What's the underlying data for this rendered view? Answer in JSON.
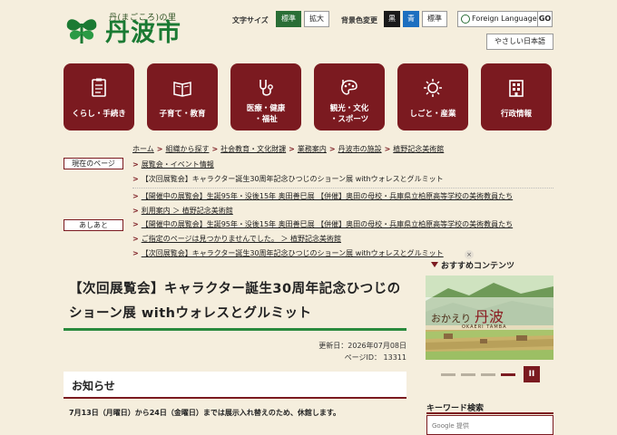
{
  "site": {
    "tagline": "丹(まごころ)の里",
    "name": "丹波市"
  },
  "utility": {
    "font_size_label": "文字サイズ",
    "font_standard": "標準",
    "font_large": "拡大",
    "bg_label": "背景色変更",
    "bg_black": "黒",
    "bg_blue": "青",
    "bg_standard": "標準",
    "language": "Foreign Language",
    "go": "GO",
    "easy_japanese": "やさしい日本語"
  },
  "nav": [
    {
      "label": "くらし・手続き",
      "icon": "document-icon"
    },
    {
      "label": "子育て・教育",
      "icon": "book-icon"
    },
    {
      "label": "医療・健康\n・福祉",
      "icon": "stethoscope-icon"
    },
    {
      "label": "観光・文化\n・スポーツ",
      "icon": "palette-icon"
    },
    {
      "label": "しごと・産業",
      "icon": "sun-icon"
    },
    {
      "label": "行政情報",
      "icon": "building-icon"
    }
  ],
  "breadcrumb": {
    "current_label": "現在のページ",
    "current_path": [
      "ホーム",
      "組織から探す",
      "社会教育・文化財課",
      "業務案内",
      "丹波市の施設",
      "植野記念美術館"
    ],
    "current_sub": "展覧会・イベント情報",
    "current_page": "【次回展覧会】キャラクター誕生30周年記念ひつじのショーン展 withウォレスとグルミット",
    "history_label": "あしあと",
    "history": [
      "【開催中の展覧会】生誕95年・没後15年 奥田善巳展 【併催】奥田の母校・兵庫県立柏原高等学校の美術教員たち",
      "利用案内 ＞ 植野記念美術館",
      "【開催中の展覧会】生誕95年・没後15年 奥田善巳展 【併催】奥田の母校・兵庫県立柏原高等学校の美術教員たち",
      "ご指定のページは見つかりませんでした。 ＞ 植野記念美術館",
      "【次回展覧会】キャラクター誕生30周年記念ひつじのショーン展 withウォレスとグルミット"
    ]
  },
  "article": {
    "title": "【次回展覧会】キャラクター誕生30周年記念ひつじのショーン展 withウォレスとグルミット",
    "updated": "更新日：2026年07月08日",
    "page_id": "ページID： 13311",
    "notice_heading": "お知らせ",
    "notice_text": "7月13日（月曜日）から24日（金曜日）までは展示入れ替えのため、休館します。"
  },
  "sidebar": {
    "recommended_title": "おすすめコンテンツ",
    "banner_small": "おかえり",
    "banner_big": "丹波",
    "banner_sub": "OKAERI TAMBA",
    "close": "×",
    "pause": "II",
    "keyword_title": "キーワード検索",
    "search_placeholder": "Google 提供"
  },
  "colors": {
    "accent": "#7b1a20",
    "green": "#2a8a3d",
    "background": "#f5eedd"
  }
}
